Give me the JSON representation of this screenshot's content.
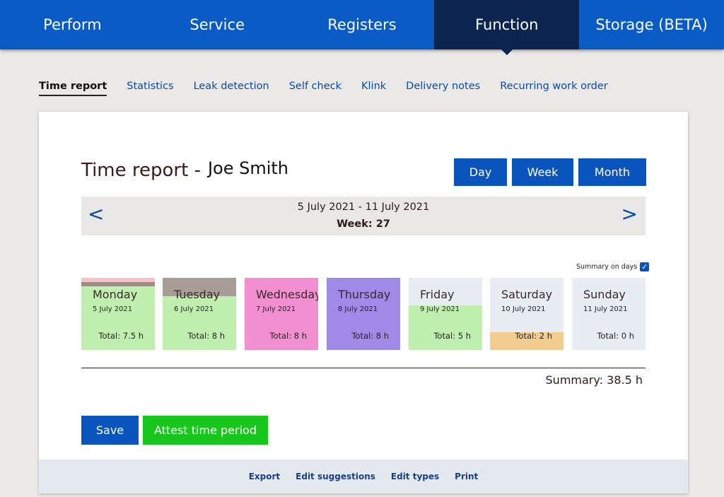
{
  "topnav": {
    "items": [
      {
        "label": "Perform"
      },
      {
        "label": "Service"
      },
      {
        "label": "Registers"
      },
      {
        "label": "Function"
      },
      {
        "label": "Storage (BETA)"
      }
    ],
    "active_index": 3
  },
  "subnav": {
    "items": [
      {
        "label": "Time report"
      },
      {
        "label": "Statistics"
      },
      {
        "label": "Leak detection"
      },
      {
        "label": "Self check"
      },
      {
        "label": "Klink"
      },
      {
        "label": "Delivery notes"
      },
      {
        "label": "Recurring work order"
      }
    ],
    "active_index": 0
  },
  "report": {
    "title": "Time report -",
    "person": "Joe Smith",
    "view_buttons": {
      "day": "Day",
      "week": "Week",
      "month": "Month"
    },
    "period": {
      "range": "5 July 2021 - 11 July 2021",
      "week": "Week: 27",
      "prev_icon": "<",
      "next_icon": ">"
    },
    "summary_on_days": {
      "label": "Summary on days",
      "checked": true
    },
    "days": [
      {
        "name": "Monday",
        "date": "5 July 2021",
        "total": "Total: 7.5 h",
        "colors": {
          "base": "#c0f0b0",
          "top": "#f3c3c8",
          "mid": "#9b8e87"
        }
      },
      {
        "name": "Tuesday",
        "date": "6 July 2021",
        "total": "Total: 8 h",
        "colors": {
          "base": "#c0f0b0",
          "top": "#a89c96"
        }
      },
      {
        "name": "Wednesday",
        "date": "7 July 2021",
        "total": "Total: 8 h",
        "colors": {
          "base": "#f28fd0"
        }
      },
      {
        "name": "Thursday",
        "date": "8 July 2021",
        "total": "Total: 8 h",
        "colors": {
          "base": "#a08ae8"
        }
      },
      {
        "name": "Friday",
        "date": "9 July 2021",
        "total": "Total: 5 h",
        "colors": {
          "base": "#c0f0b0",
          "top": "#e8ecf3"
        }
      },
      {
        "name": "Saturday",
        "date": "10 July 2021",
        "total": "Total: 2 h",
        "colors": {
          "base": "#f3cd90",
          "top": "#e8ecf3"
        }
      },
      {
        "name": "Sunday",
        "date": "11 July 2021",
        "total": "Total: 0 h",
        "colors": {
          "base": "#e8ecf3"
        }
      }
    ],
    "summary": "Summary: 38.5 h",
    "save_label": "Save",
    "attest_label": "Attest time period"
  },
  "footer": {
    "links": [
      "Export",
      "Edit suggestions",
      "Edit types",
      "Print"
    ]
  },
  "colors": {
    "nav_blue": "#0a5bc5",
    "nav_active": "#0c2450",
    "button_blue": "#0a55bd",
    "attest_green": "#18c71c"
  }
}
